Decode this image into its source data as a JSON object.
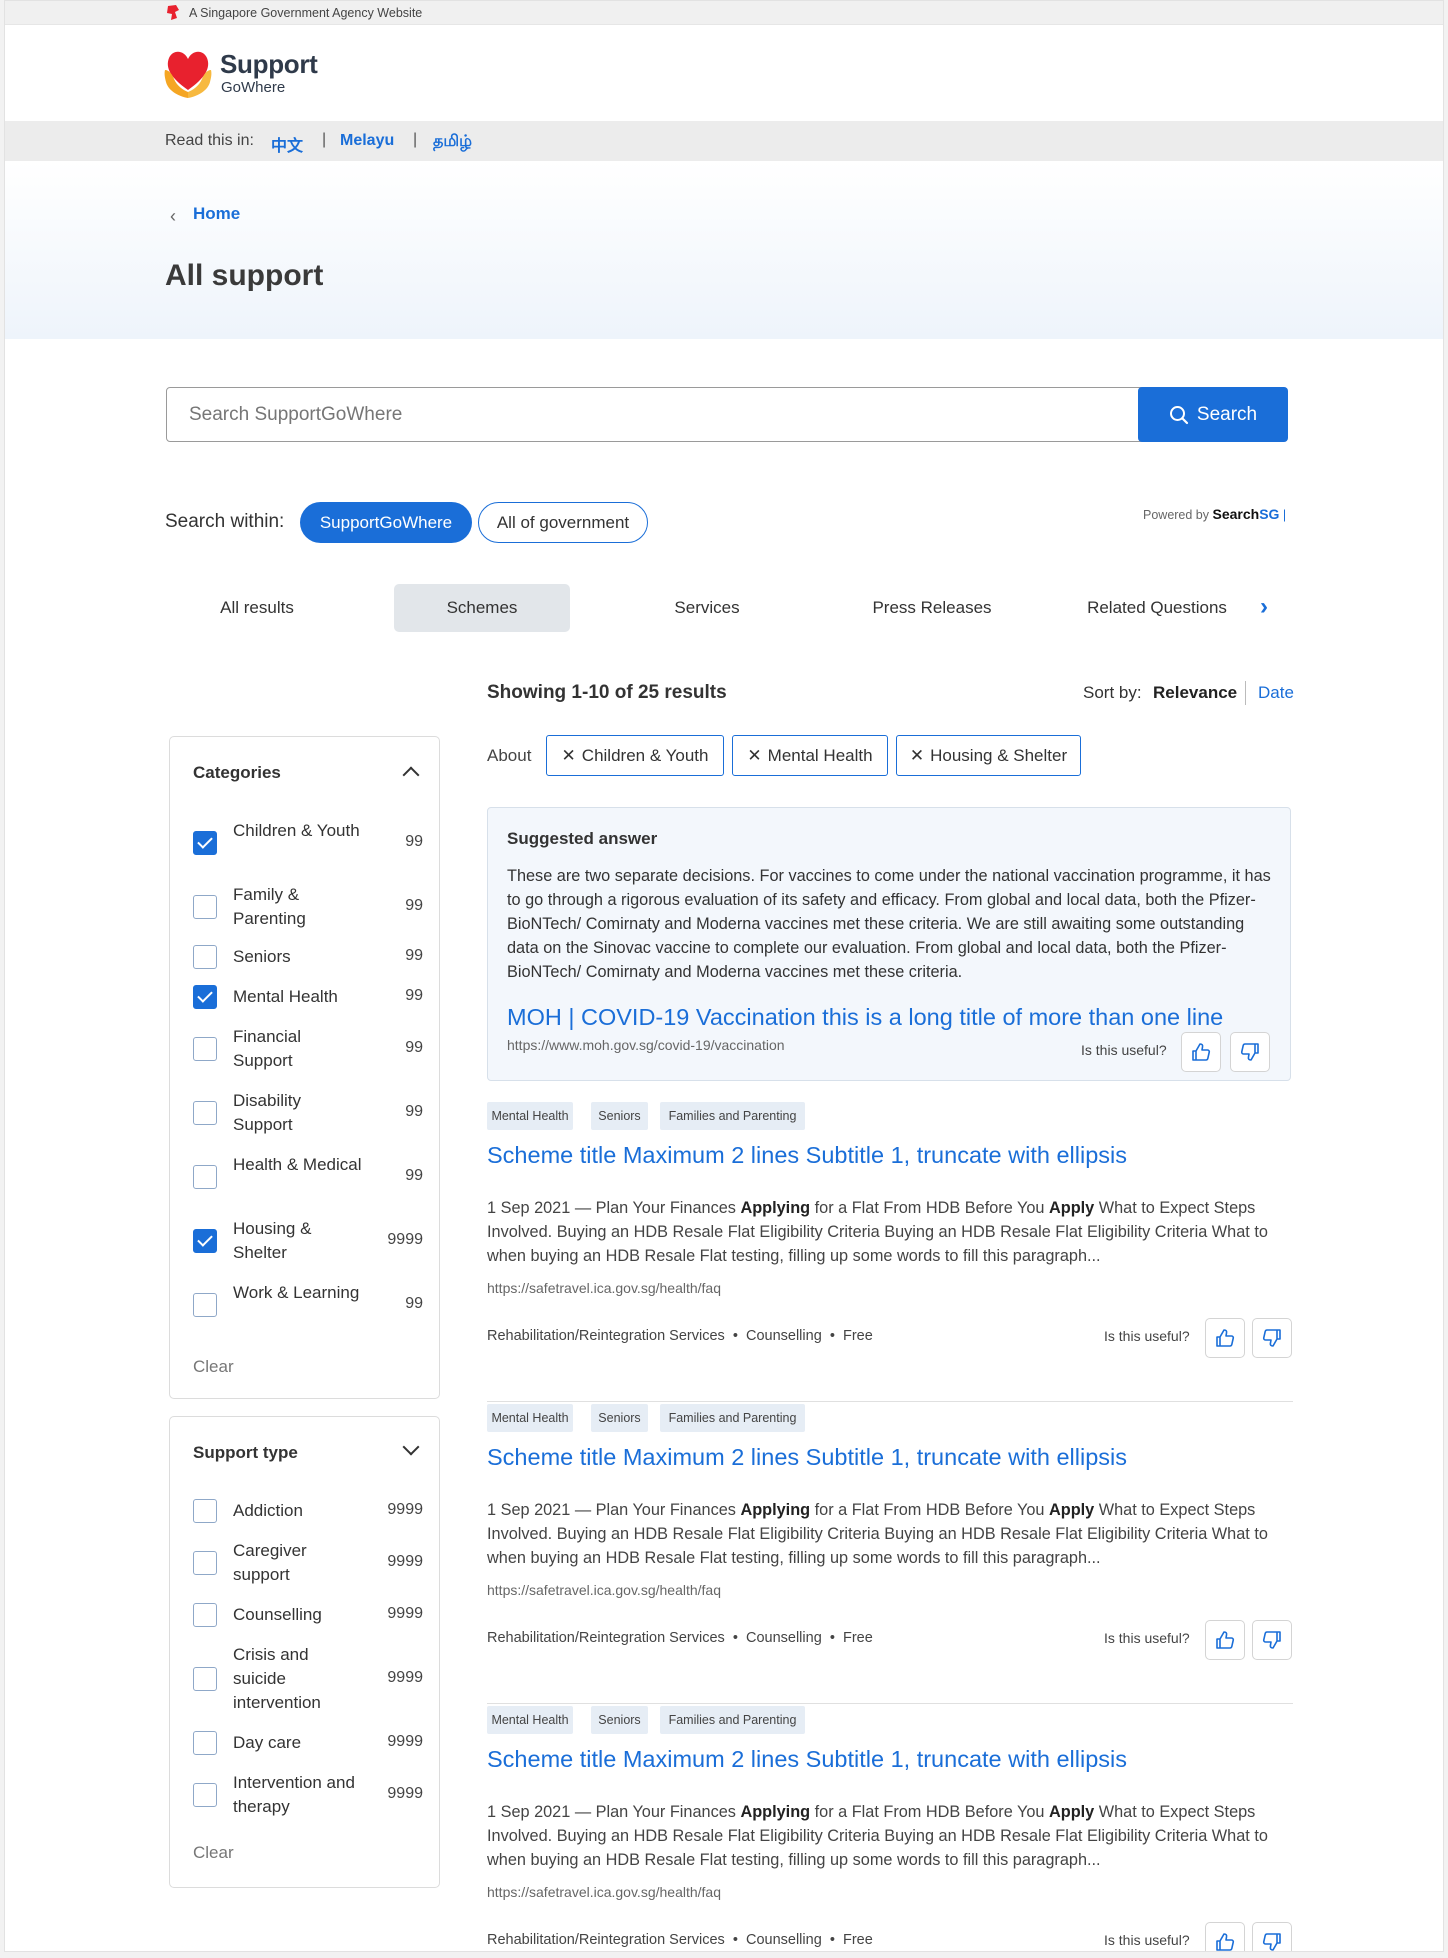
{
  "masthead": {
    "text": "A Singapore Government Agency Website"
  },
  "logo": {
    "title": "Support",
    "subtitle": "GoWhere"
  },
  "language": {
    "label": "Read this in:",
    "options": [
      "中文",
      "Melayu",
      "தமிழ்"
    ],
    "separator": "|"
  },
  "breadcrumb": {
    "home": "Home"
  },
  "page": {
    "title": "All support"
  },
  "search": {
    "placeholder": "Search SupportGoWhere",
    "button": "Search"
  },
  "scope": {
    "label": "Search within:",
    "options": [
      "SupportGoWhere",
      "All of government"
    ],
    "powered_prefix": "Powered by",
    "powered_brand": "Search",
    "powered_brand_accent": "SG"
  },
  "tabs": [
    "All results",
    "Schemes",
    "Services",
    "Press Releases",
    "Related Questions"
  ],
  "results_header": {
    "showing": "Showing 1-10 of 25 results",
    "sort_label": "Sort by:",
    "sort_relevance": "Relevance",
    "sort_date": "Date"
  },
  "about": {
    "label": "About",
    "chips": [
      "Children & Youth",
      "Mental Health",
      "Housing & Shelter"
    ]
  },
  "categories": {
    "title": "Categories",
    "items": [
      {
        "label": "Children & Youth",
        "count": "99",
        "checked": true
      },
      {
        "label": "Family & Parenting",
        "count": "99",
        "checked": false
      },
      {
        "label": "Seniors",
        "count": "99",
        "checked": false
      },
      {
        "label": "Mental Health",
        "count": "99",
        "checked": true
      },
      {
        "label": "Financial Support",
        "count": "99",
        "checked": false
      },
      {
        "label": "Disability Support",
        "count": "99",
        "checked": false
      },
      {
        "label": "Health & Medical",
        "count": "99",
        "checked": false
      },
      {
        "label": "Housing & Shelter",
        "count": "9999",
        "checked": true
      },
      {
        "label": "Work & Learning",
        "count": "99",
        "checked": false
      }
    ],
    "clear": "Clear"
  },
  "support_type": {
    "title": "Support type",
    "items": [
      {
        "label": "Addiction",
        "count": "9999",
        "checked": false
      },
      {
        "label": "Caregiver support",
        "count": "9999",
        "checked": false
      },
      {
        "label": "Counselling",
        "count": "9999",
        "checked": false
      },
      {
        "label": "Crisis and suicide intervention",
        "count": "9999",
        "checked": false
      },
      {
        "label": "Day care",
        "count": "9999",
        "checked": false
      },
      {
        "label": "Intervention and therapy",
        "count": "9999",
        "checked": false
      }
    ],
    "clear": "Clear"
  },
  "suggested": {
    "heading": "Suggested answer",
    "body": "These are two separate decisions. For vaccines to come under the national vaccination programme, it has to go through a rigorous evaluation of its safety and efficacy. From global and local data, both the Pfizer-BioNTech/ Comirnaty and Moderna vaccines met these criteria. We are still awaiting some outstanding data on the Sinovac vaccine to complete our evaluation. From global and local data, both the Pfizer-BioNTech/ Comirnaty and Moderna vaccines met these criteria.",
    "link": "MOH | COVID-19 Vaccination this is a long title of more than one line",
    "url": "https://www.moh.gov.sg/covid-19/vaccination",
    "useful": "Is this useful?"
  },
  "results": [
    {
      "tags": [
        "Mental Health",
        "Seniors",
        "Families and Parenting"
      ],
      "title": "Scheme title Maximum 2 lines Subtitle 1, truncate with ellipsis",
      "date": "1 Sep 2021",
      "snippet_parts": [
        " — Plan Your Finances ",
        "Applying",
        " for a Flat From HDB Before You ",
        "Apply",
        " What to Expect Steps Involved. Buying an HDB Resale Flat Eligibility Criteria Buying an HDB Resale Flat Eligibility Criteria What to when buying an HDB Resale Flat testing, filling up some words to fill this paragraph..."
      ],
      "url": "https://safetravel.ica.gov.sg/health/faq",
      "meta": [
        "Rehabilitation/Reintegration Services",
        "Counselling",
        "Free"
      ],
      "useful": "Is this useful?"
    },
    {
      "tags": [
        "Mental Health",
        "Seniors",
        "Families and Parenting"
      ],
      "title": "Scheme title Maximum 2 lines Subtitle 1, truncate with ellipsis",
      "date": "1 Sep 2021",
      "snippet_parts": [
        " — Plan Your Finances ",
        "Applying",
        " for a Flat From HDB Before You ",
        "Apply",
        " What to Expect Steps Involved. Buying an HDB Resale Flat Eligibility Criteria Buying an HDB Resale Flat Eligibility Criteria What to when buying an HDB Resale Flat testing, filling up some words to fill this paragraph..."
      ],
      "url": "https://safetravel.ica.gov.sg/health/faq",
      "meta": [
        "Rehabilitation/Reintegration Services",
        "Counselling",
        "Free"
      ],
      "useful": "Is this useful?"
    },
    {
      "tags": [
        "Mental Health",
        "Seniors",
        "Families and Parenting"
      ],
      "title": "Scheme title Maximum 2 lines Subtitle 1, truncate with ellipsis",
      "date": "1 Sep 2021",
      "snippet_parts": [
        " — Plan Your Finances ",
        "Applying",
        " for a Flat From HDB Before You ",
        "Apply",
        " What to Expect Steps Involved. Buying an HDB Resale Flat Eligibility Criteria Buying an HDB Resale Flat Eligibility Criteria What to when buying an HDB Resale Flat testing, filling up some words to fill this paragraph..."
      ],
      "url": "https://safetravel.ica.gov.sg/health/faq",
      "meta": [
        "Rehabilitation/Reintegration Services",
        "Counselling",
        "Free"
      ],
      "useful": "Is this useful?"
    }
  ],
  "colors": {
    "primary": "#1a6ed8",
    "tag_bg": "#e6edf5",
    "suggest_bg": "#f3f7fc",
    "masthead_bg": "#f0f0f0",
    "heart_red": "#e8212e",
    "heart_hand": "#f5a623"
  },
  "icons": [
    "lion-head-icon",
    "heart-hands-logo-icon",
    "chevron-left-icon",
    "search-icon",
    "chevron-right-icon",
    "close-icon",
    "checkbox-checked-icon",
    "chevron-up-icon",
    "chevron-down-icon",
    "thumbs-up-icon",
    "thumbs-down-icon"
  ]
}
